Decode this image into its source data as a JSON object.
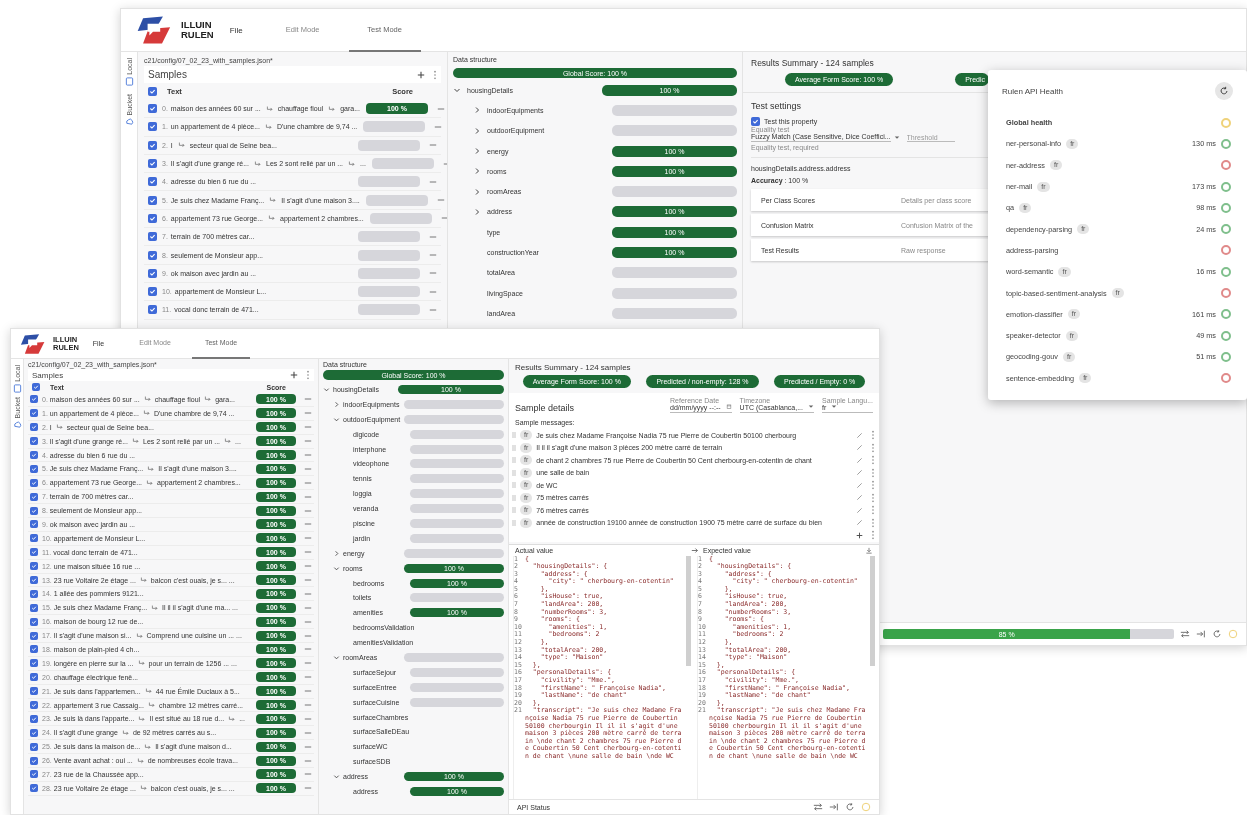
{
  "back_window": {
    "logo": {
      "line_1": "ILLUIN",
      "line_2": "RULEN"
    },
    "menu": "File",
    "tabs": [
      {
        "label": "Edit Mode",
        "selected": false
      },
      {
        "label": "Test Mode",
        "selected": true
      }
    ],
    "rail": [
      {
        "label": "Local",
        "kind": "device"
      },
      {
        "label": "Bucket",
        "kind": "cloud"
      }
    ],
    "file_path": "c21/config/07_02_23_with_samples.json*",
    "samples": {
      "title": "Samples",
      "header_checked": true,
      "columns": [
        "Text",
        "Score"
      ],
      "rows": [
        {
          "index": "0.",
          "segments": [
            "maison des années 60 sur ...",
            "chauffage fioul",
            "gara..."
          ],
          "checked": true,
          "score": "100 %"
        },
        {
          "index": "1.",
          "segments": [
            "un appartement de 4 pièce...",
            "D'une chambre de 9,74 ..."
          ],
          "checked": true
        },
        {
          "index": "2.",
          "segments": [
            "I",
            "secteur quai de Seine bea..."
          ],
          "checked": true
        },
        {
          "index": "3.",
          "segments": [
            "Il s'agit d'une grange ré...",
            "Les 2 sont relié par un ...",
            "..."
          ],
          "checked": true
        },
        {
          "index": "4.",
          "segments": [
            "adresse du bien 6 rue du ..."
          ],
          "checked": true
        },
        {
          "index": "5.",
          "segments": [
            "Je suis chez Madame Franç...",
            "Il s'agit d'une maison 3...."
          ],
          "checked": true
        },
        {
          "index": "6.",
          "segments": [
            "appartement 73 rue George...",
            "appartement 2 chambres..."
          ],
          "checked": true
        },
        {
          "index": "7.",
          "segments": [
            "terrain de 700 mètres car..."
          ],
          "checked": true
        },
        {
          "index": "8.",
          "segments": [
            "seulement de Monsieur app..."
          ],
          "checked": true
        },
        {
          "index": "9.",
          "segments": [
            "ok maison avec jardin au ..."
          ],
          "checked": true
        },
        {
          "index": "10.",
          "segments": [
            "appartement de Monsieur L..."
          ],
          "checked": true
        },
        {
          "index": "11.",
          "segments": [
            "vocal donc terrain de 471..."
          ],
          "checked": true
        }
      ]
    },
    "data_structure": {
      "title": "Data structure",
      "global_score": "Global Score: 100 %",
      "tree": [
        {
          "label": "housingDetails",
          "expanded": true,
          "kind": "scored",
          "score": "100 %",
          "children": [
            {
              "label": "indoorEquipments",
              "expanded": false,
              "kind": "unscored"
            },
            {
              "label": "outdoorEquipment",
              "expanded": false,
              "kind": "unscored"
            },
            {
              "label": "energy",
              "expanded": false,
              "kind": "scored",
              "score": "100 %"
            },
            {
              "label": "rooms",
              "expanded": false,
              "kind": "scored",
              "score": "100 %"
            },
            {
              "label": "roomAreas",
              "expanded": false,
              "kind": "unscored"
            },
            {
              "label": "address",
              "expanded": false,
              "kind": "scored",
              "score": "100 %"
            },
            {
              "label": "type",
              "kind": "scored",
              "score": "100 %"
            },
            {
              "label": "constructionYear",
              "kind": "scored",
              "score": "100 %"
            },
            {
              "label": "totalArea",
              "kind": "unscored"
            },
            {
              "label": "livingSpace",
              "kind": "unscored"
            },
            {
              "label": "landArea",
              "kind": "unscored"
            }
          ]
        }
      ]
    },
    "results": {
      "title": "Results Summary - 124 samples",
      "pills": [
        "Average Form Score: 100 %",
        "Predic"
      ],
      "test_settings": {
        "title": "Test settings",
        "checkbox_label": "Test this property",
        "checked": true,
        "select_label": "Equality test",
        "select_value": "Fuzzy Match (Case Sensitive, Dice Coeffici...",
        "threshold_placeholder": "Threshold",
        "helper": "Equality test, required"
      },
      "property_path": "housingDetails.address.address",
      "accuracy": "**Accuracy** : 100 %",
      "panels": [
        {
          "title": "Per Class Scores",
          "description": "Details per class score"
        },
        {
          "title": "Confusion Matrix",
          "description": "Confusion Matrix of the"
        },
        {
          "title": "Test Results",
          "description": "Raw response"
        }
      ]
    },
    "status_bar": {
      "progress_label": "85 %",
      "level": 0.85
    }
  },
  "api_health": {
    "title": "Rulen API Health",
    "global": {
      "label": "Global health",
      "color": "#efd27a"
    },
    "services": [
      {
        "name": "ner-personal-info",
        "lang": "fr",
        "latency": "130 ms",
        "color": "#7fbf8c"
      },
      {
        "name": "ner-address",
        "lang": "fr",
        "color": "#e08a8a"
      },
      {
        "name": "ner-mail",
        "lang": "fr",
        "latency": "173 ms",
        "color": "#7fbf8c"
      },
      {
        "name": "qa",
        "lang": "fr",
        "latency": "98 ms",
        "color": "#7fbf8c"
      },
      {
        "name": "dependency-parsing",
        "lang": "fr",
        "latency": "24 ms",
        "color": "#7fbf8c"
      },
      {
        "name": "address-parsing",
        "color": "#e08a8a"
      },
      {
        "name": "word-semantic",
        "lang": "fr",
        "latency": "16 ms",
        "color": "#7fbf8c"
      },
      {
        "name": "topic-based-sentiment-analysis",
        "lang": "fr",
        "color": "#e08a8a"
      },
      {
        "name": "emotion-classifier",
        "lang": "fr",
        "latency": "161 ms",
        "color": "#7fbf8c"
      },
      {
        "name": "speaker-detector",
        "lang": "fr",
        "latency": "49 ms",
        "color": "#7fbf8c"
      },
      {
        "name": "geocoding-gouv",
        "lang": "fr",
        "latency": "51 ms",
        "color": "#7fbf8c"
      },
      {
        "name": "sentence-embedding",
        "lang": "fr",
        "color": "#e08a8a"
      }
    ]
  },
  "front_window": {
    "logo": {
      "line_1": "ILLUIN",
      "line_2": "RULEN"
    },
    "menu": "File",
    "tabs": [
      {
        "label": "Edit Mode",
        "selected": false
      },
      {
        "label": "Test Mode",
        "selected": true
      }
    ],
    "rail": [
      {
        "label": "Local",
        "kind": "device"
      },
      {
        "label": "Bucket",
        "kind": "cloud"
      }
    ],
    "file_path": "c21/config/07_02_23_with_samples.json*",
    "samples": {
      "title": "Samples",
      "header_checked": true,
      "columns": [
        "Text",
        "Score"
      ],
      "rows": [
        {
          "index": "0.",
          "segments": [
            "maison des années 60 sur ...",
            "chauffage fioul",
            "gara..."
          ],
          "checked": true,
          "score": "100 %"
        },
        {
          "index": "1.",
          "segments": [
            "un appartement de 4 pièce...",
            "D'une chambre de 9,74 ..."
          ],
          "checked": true,
          "score": "100 %"
        },
        {
          "index": "2.",
          "segments": [
            "I",
            "secteur quai de Seine bea..."
          ],
          "checked": true,
          "score": "100 %"
        },
        {
          "index": "3.",
          "segments": [
            "Il s'agit d'une grange ré...",
            "Les 2 sont relié par un ...",
            "..."
          ],
          "checked": true,
          "score": "100 %"
        },
        {
          "index": "4.",
          "segments": [
            "adresse du bien 6 rue du ..."
          ],
          "checked": true,
          "score": "100 %"
        },
        {
          "index": "5.",
          "segments": [
            "Je suis chez Madame Franç...",
            "Il s'agit d'une maison 3...."
          ],
          "checked": true,
          "score": "100 %"
        },
        {
          "index": "6.",
          "segments": [
            "appartement 73 rue George...",
            "appartement 2 chambres..."
          ],
          "checked": true,
          "score": "100 %"
        },
        {
          "index": "7.",
          "segments": [
            "terrain de 700 mètres car..."
          ],
          "checked": true,
          "score": "100 %"
        },
        {
          "index": "8.",
          "segments": [
            "seulement de Monsieur app..."
          ],
          "checked": true,
          "score": "100 %"
        },
        {
          "index": "9.",
          "segments": [
            "ok maison avec jardin au ..."
          ],
          "checked": true,
          "score": "100 %"
        },
        {
          "index": "10.",
          "segments": [
            "appartement de Monsieur L..."
          ],
          "checked": true,
          "score": "100 %"
        },
        {
          "index": "11.",
          "segments": [
            "vocal donc terrain de 471..."
          ],
          "checked": true,
          "score": "100 %"
        },
        {
          "index": "12.",
          "segments": [
            "une maison située 16 rue ..."
          ],
          "checked": true,
          "score": "100 %"
        },
        {
          "index": "13.",
          "segments": [
            "23 rue Voltaire 2e étage ...",
            "balcon c'est ouais, je s... ..."
          ],
          "checked": true,
          "score": "100 %"
        },
        {
          "index": "14.",
          "segments": [
            "1 allée des pommiers 9121..."
          ],
          "checked": true,
          "score": "100 %"
        },
        {
          "index": "15.",
          "segments": [
            "Je suis chez Madame Franç...",
            "Il il il s'agit d'une ma... ..."
          ],
          "checked": true,
          "score": "100 %"
        },
        {
          "index": "16.",
          "segments": [
            "maison de bourg 12 rue de..."
          ],
          "checked": true,
          "score": "100 %"
        },
        {
          "index": "17.",
          "segments": [
            "Il s'agit d'une maison si...",
            "Comprend une cuisine un ... ..."
          ],
          "checked": true,
          "score": "100 %"
        },
        {
          "index": "18.",
          "segments": [
            "maison de plain-pied 4 ch..."
          ],
          "checked": true,
          "score": "100 %"
        },
        {
          "index": "19.",
          "segments": [
            "longère en pierre sur la ...",
            "pour un terrain de 1256 ... ..."
          ],
          "checked": true,
          "score": "100 %"
        },
        {
          "index": "20.",
          "segments": [
            "chauffage électrique fenê..."
          ],
          "checked": true,
          "score": "100 %"
        },
        {
          "index": "21.",
          "segments": [
            "Je suis dans l'appartemen...",
            "44 rue Émile Duclaux à 5..."
          ],
          "checked": true,
          "score": "100 %"
        },
        {
          "index": "22.",
          "segments": [
            "appartement 3 rue Cassaig...",
            "chambre 12 mètres carré..."
          ],
          "checked": true,
          "score": "100 %"
        },
        {
          "index": "23.",
          "segments": [
            "Je suis là dans l'apparte...",
            "Il est situé au 18 rue d...",
            "..."
          ],
          "checked": true,
          "score": "100 %"
        },
        {
          "index": "24.",
          "segments": [
            "Il s'agit d'une grange",
            "de 92 mètres carrés au s..."
          ],
          "checked": true,
          "score": "100 %"
        },
        {
          "index": "25.",
          "segments": [
            "Je suis dans la maison de...",
            "Il s'agit d'une maison d..."
          ],
          "checked": true,
          "score": "100 %"
        },
        {
          "index": "26.",
          "segments": [
            "Vente avant achat : oui ...",
            "de nombreuses école trava..."
          ],
          "checked": true,
          "score": "100 %"
        },
        {
          "index": "27.",
          "segments": [
            "23 rue de la Chaussée app..."
          ],
          "checked": true,
          "score": "100 %"
        },
        {
          "index": "28.",
          "segments": [
            "23 rue Voltaire 2e étage ...",
            "balcon c'est ouais, je s... ..."
          ],
          "checked": true,
          "score": "100 %"
        }
      ]
    },
    "data_structure": {
      "title": "Data structure",
      "global_score": "Global Score: 100 %",
      "tree": [
        {
          "label": "housingDetails",
          "expanded": true,
          "kind": "scored",
          "score": "100 %",
          "children": [
            {
              "label": "indoorEquipments",
              "expanded": false,
              "kind": "unscored"
            },
            {
              "label": "outdoorEquipment",
              "expanded": true,
              "kind": "unscored",
              "children": [
                {
                  "label": "digicode",
                  "kind": "unscored"
                },
                {
                  "label": "interphone",
                  "kind": "unscored"
                },
                {
                  "label": "videophone",
                  "kind": "unscored"
                },
                {
                  "label": "tennis",
                  "kind": "unscored"
                },
                {
                  "label": "loggia",
                  "kind": "unscored"
                },
                {
                  "label": "veranda",
                  "kind": "unscored"
                },
                {
                  "label": "piscine",
                  "kind": "unscored"
                },
                {
                  "label": "jardin",
                  "kind": "unscored"
                }
              ]
            },
            {
              "label": "energy",
              "expanded": false,
              "kind": "unscored"
            },
            {
              "label": "rooms",
              "expanded": true,
              "kind": "scored",
              "score": "100 %",
              "children": [
                {
                  "label": "bedrooms",
                  "kind": "scored",
                  "score": "100 %"
                },
                {
                  "label": "toilets",
                  "kind": "unscored"
                },
                {
                  "label": "amenities",
                  "kind": "scored",
                  "score": "100 %"
                },
                {
                  "label": "bedroomsValidation",
                  "kind": "none"
                },
                {
                  "label": "amenitiesValidation",
                  "kind": "none"
                }
              ]
            },
            {
              "label": "roomAreas",
              "expanded": true,
              "kind": "unscored",
              "children": [
                {
                  "label": "surfaceSejour",
                  "kind": "unscored"
                },
                {
                  "label": "surfaceEntree",
                  "kind": "unscored"
                },
                {
                  "label": "surfaceCuisine",
                  "kind": "unscored"
                },
                {
                  "label": "surfaceChambres",
                  "kind": "none"
                },
                {
                  "label": "surfaceSalleDEau",
                  "kind": "none"
                },
                {
                  "label": "surfaceWC",
                  "kind": "none"
                },
                {
                  "label": "surfaceSDB",
                  "kind": "none"
                }
              ]
            },
            {
              "label": "address",
              "expanded": true,
              "kind": "scored",
              "score": "100 %",
              "children": [
                {
                  "label": "address",
                  "kind": "scored",
                  "score": "100 %"
                }
              ]
            }
          ]
        }
      ]
    },
    "results": {
      "title": "Results Summary - 124 samples",
      "pills": [
        "Average Form Score: 100 %",
        "Predicted / non-empty: 128 %",
        "Predicted / Empty: 0 %"
      ],
      "sample_details": {
        "title": "Sample details",
        "fields": [
          {
            "label": "Reference Date",
            "value": "dd/mm/yyyy --:--",
            "kind": "date"
          },
          {
            "label": "Timezone",
            "value": "UTC (Casablanca,...",
            "kind": "select"
          },
          {
            "label": "Sample Langu...",
            "value": "fr",
            "kind": "select"
          }
        ],
        "messages_label": "Sample messages:",
        "messages": [
          {
            "lang": "fr",
            "text": "Je suis chez Madame Françoise Nadia 75 rue Pierre de Coubertin 50100 cherbourg"
          },
          {
            "lang": "fr",
            "text": "Il il il s'agit d'une maison 3 pièces 200 mètre carré de terrain"
          },
          {
            "lang": "fr",
            "text": "de chant 2 chambres 75 rue Pierre de Coubertin 50 Cent cherbourg-en-cotentin de chant"
          },
          {
            "lang": "fr",
            "text": "une salle de bain"
          },
          {
            "lang": "fr",
            "text": "de WC"
          },
          {
            "lang": "fr",
            "text": "75 mètres carrés"
          },
          {
            "lang": "fr",
            "text": "76 mètres carrés"
          },
          {
            "lang": "fr",
            "text": "année de construction 19100 année de construction 1900 75 mètre carré de surface du bien"
          }
        ]
      },
      "editors": [
        {
          "title": "Actual value",
          "lines": [
            {
              "n": "1",
              "text": "{"
            },
            {
              "n": "2",
              "text": "  \"housingDetails\": {"
            },
            {
              "n": "3",
              "text": "    \"address\": {"
            },
            {
              "n": "4",
              "text": "      \"city\": \" cherbourg-en-cotentin\""
            },
            {
              "n": "5",
              "text": "    },"
            },
            {
              "n": "6",
              "text": "    \"isHouse\": true,"
            },
            {
              "n": "7",
              "text": "    \"landArea\": 200,"
            },
            {
              "n": "8",
              "text": "    \"numberRooms\": 3,"
            },
            {
              "n": "9",
              "text": "    \"rooms\": {"
            },
            {
              "n": "10",
              "text": "      \"amenities\": 1,"
            },
            {
              "n": "11",
              "text": "      \"bedrooms\": 2"
            },
            {
              "n": "12",
              "text": "    },"
            },
            {
              "n": "13",
              "text": "    \"totalArea\": 200,"
            },
            {
              "n": "14",
              "text": "    \"type\": \"Maison\""
            },
            {
              "n": "15",
              "text": "  },"
            },
            {
              "n": "16",
              "text": "  \"personalDetails\": {"
            },
            {
              "n": "17",
              "text": "    \"civility\": \"Mme.\","
            },
            {
              "n": "18",
              "text": "    \"firstName\": \" Françoise Nadia\","
            },
            {
              "n": "19",
              "text": "    \"lastName\": \"de chant\""
            },
            {
              "n": "20",
              "text": "  },"
            },
            {
              "n": "21",
              "text": "  \"transcript\": \"Je suis chez Madame Françoise Nadia 75 rue Pierre de Coubertin 50100 cherbourgin Il il il s'agit d'une maison 3 pièces 200 mètre carré de terrain \\nde chant 2 chambres 75 rue Pierre de Coubertin 50 Cent cherbourg-en-cotentin de chant \\nune salle de bain \\nde WC"
            }
          ]
        },
        {
          "title": "Expected value",
          "lines": [
            {
              "n": "1",
              "text": "{"
            },
            {
              "n": "2",
              "text": "  \"housingDetails\": {"
            },
            {
              "n": "3",
              "text": "    \"address\": {"
            },
            {
              "n": "4",
              "text": "      \"city\": \" cherbourg-en-cotentin\""
            },
            {
              "n": "5",
              "text": "    },"
            },
            {
              "n": "6",
              "text": "    \"isHouse\": true,"
            },
            {
              "n": "7",
              "text": "    \"landArea\": 200,"
            },
            {
              "n": "8",
              "text": "    \"numberRooms\": 3,"
            },
            {
              "n": "9",
              "text": "    \"rooms\": {"
            },
            {
              "n": "10",
              "text": "      \"amenities\": 1,"
            },
            {
              "n": "11",
              "text": "      \"bedrooms\": 2"
            },
            {
              "n": "12",
              "text": "    },"
            },
            {
              "n": "13",
              "text": "    \"totalArea\": 200,"
            },
            {
              "n": "14",
              "text": "    \"type\": \"Maison\""
            },
            {
              "n": "15",
              "text": "  },"
            },
            {
              "n": "16",
              "text": "  \"personalDetails\": {"
            },
            {
              "n": "17",
              "text": "    \"civility\": \"Mme.\","
            },
            {
              "n": "18",
              "text": "    \"firstName\": \" Françoise Nadia\","
            },
            {
              "n": "19",
              "text": "    \"lastName\": \"de chant\""
            },
            {
              "n": "20",
              "text": "  },"
            },
            {
              "n": "21",
              "text": "  \"transcript\": \"Je suis chez Madame Françoise Nadia 75 rue Pierre de Coubertin 50100 cherbourgin Il il il s'agit d'une maison 3 pièces 200 mètre carré de terrain \\nde chant 2 chambres 75 rue Pierre de Coubertin 50 Cent cherbourg-en-cotentin de chant \\nune salle de bain \\nde WC"
            }
          ]
        }
      ]
    },
    "status_bar": {
      "label": "API Status"
    }
  }
}
